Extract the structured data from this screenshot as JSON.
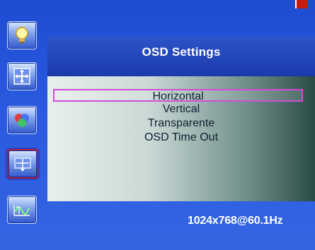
{
  "window": {
    "title": "OSD Settings"
  },
  "menu": {
    "items": [
      "Horizontal",
      "Vertical",
      "Transparente",
      "OSD Time Out"
    ],
    "selected_item": "Horizontal"
  },
  "status": {
    "resolution": "1024x768@60.1Hz"
  },
  "sidebar": {
    "icons": [
      "lightbulb-icon",
      "position-arrows-icon",
      "rgb-color-icon",
      "osd-settings-icon",
      "signal-wave-icon"
    ],
    "active_icon": "osd-settings-icon"
  },
  "colors": {
    "background": "#2a5ae0",
    "panel": "#17389f",
    "selection_border": "#d24bd9",
    "corner_mark": "#c61b10"
  }
}
